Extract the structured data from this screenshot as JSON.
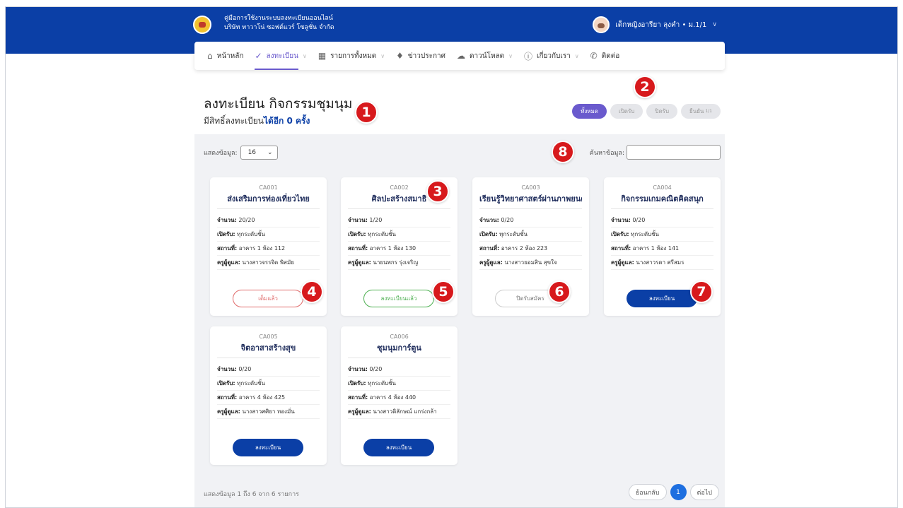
{
  "header": {
    "brand_line1": "คู่มือการใช้งานระบบลงทะเบียนออนไลน์",
    "brand_line2": "บริษัท ทาวาโน่ ซอฟต์แวร์ โซลูชั่น จำกัด",
    "user_name": "เด็กหญิงอารียา ลุงคำ • ม.1/1"
  },
  "nav": {
    "items": [
      {
        "label": "หน้าหลัก",
        "icon": "home-icon"
      },
      {
        "label": "ลงทะเบียน",
        "icon": "check-circle-icon",
        "active": true
      },
      {
        "label": "รายการทั้งหมด",
        "icon": "grid-icon"
      },
      {
        "label": "ข่าวประกาศ",
        "icon": "bell-icon"
      },
      {
        "label": "ดาวน์โหลด",
        "icon": "cloud-download-icon"
      },
      {
        "label": "เกี่ยวกับเรา",
        "icon": "info-icon"
      },
      {
        "label": "ติดต่อ",
        "icon": "phone-icon"
      }
    ]
  },
  "page": {
    "title": "ลงทะเบียน กิจกรรมชุมนุม",
    "subtitle_prefix": "มีสิทธิ์ลงทะเบียน",
    "subtitle_bold": "ได้อีก 0 ครั้ง"
  },
  "filters": [
    {
      "label": "ทั้งหมด",
      "active": true
    },
    {
      "label": "เปิดรับ"
    },
    {
      "label": "ปิดรับ"
    },
    {
      "label": "ยืนยัน",
      "sup": "1/1"
    }
  ],
  "controls": {
    "show_label": "แสดงข้อมูล:",
    "show_value": "16",
    "search_label": "ค้นหาข้อมูล:"
  },
  "field_labels": {
    "count": "จำนวน:",
    "open": "เปิดรับ:",
    "place": "สถานที่:",
    "teacher": "ครูผู้ดูแล:"
  },
  "cards": [
    {
      "code": "CA001",
      "title": "ส่งเสริมการท่องเที่ยวไทย",
      "count": "20/20",
      "open": "ทุกระดับชั้น",
      "place": "อาคาร 1 ห้อง 112",
      "teacher": "นางสาวจรรจิต พิสมัย",
      "button": "เต็มแล้ว",
      "status": "full"
    },
    {
      "code": "CA002",
      "title": "ศิลปะสร้างสมาธิ",
      "count": "1/20",
      "open": "ทุกระดับชั้น",
      "place": "อาคาร 1 ห้อง 130",
      "teacher": "นายนพกร รุ่งเจริญ",
      "button": "ลงทะเบียนแล้ว",
      "status": "done"
    },
    {
      "code": "CA003",
      "title": "เรียนรู้วิทยาศาสตร์ผ่านภาพยนตร์",
      "count": "0/20",
      "open": "ทุกระดับชั้น",
      "place": "อาคาร 2 ห้อง 223",
      "teacher": "นางสาวยอมสิน สุขใจ",
      "button": "ปิดรับสมัคร",
      "status": "closed"
    },
    {
      "code": "CA004",
      "title": "กิจกรรมเกมคณิตคิดสนุก",
      "count": "0/20",
      "open": "ทุกระดับชั้น",
      "place": "อาคาร 1 ห้อง 141",
      "teacher": "นางสาวรดา ศรีสมร",
      "button": "ลงทะเบียน",
      "status": "register"
    },
    {
      "code": "CA005",
      "title": "จิตอาสาสร้างสุข",
      "count": "0/20",
      "open": "ทุกระดับชั้น",
      "place": "อาคาร 4 ห้อง 425",
      "teacher": "นางสาวศศิยา ทองมั่น",
      "button": "ลงทะเบียน",
      "status": "register"
    },
    {
      "code": "CA006",
      "title": "ชุมนุมการ์ตูน",
      "count": "0/20",
      "open": "ทุกระดับชั้น",
      "place": "อาคาร 4 ห้อง 440",
      "teacher": "นางสาวดิลักษณ์ แกร่งกล้า",
      "button": "ลงทะเบียน",
      "status": "register"
    }
  ],
  "callouts": [
    "1",
    "2",
    "3",
    "4",
    "5",
    "6",
    "7",
    "8"
  ],
  "footer": {
    "info": "แสดงข้อมูล 1 ถึง 6 จาก 6 รายการ",
    "prev": "ย้อนกลับ",
    "page": "1",
    "next": "ต่อไป"
  },
  "colors": {
    "primary": "#0b3fa6",
    "accent": "#6a5acd",
    "danger": "#e06a6a",
    "success": "#4caf50",
    "callout": "#d7191c"
  }
}
